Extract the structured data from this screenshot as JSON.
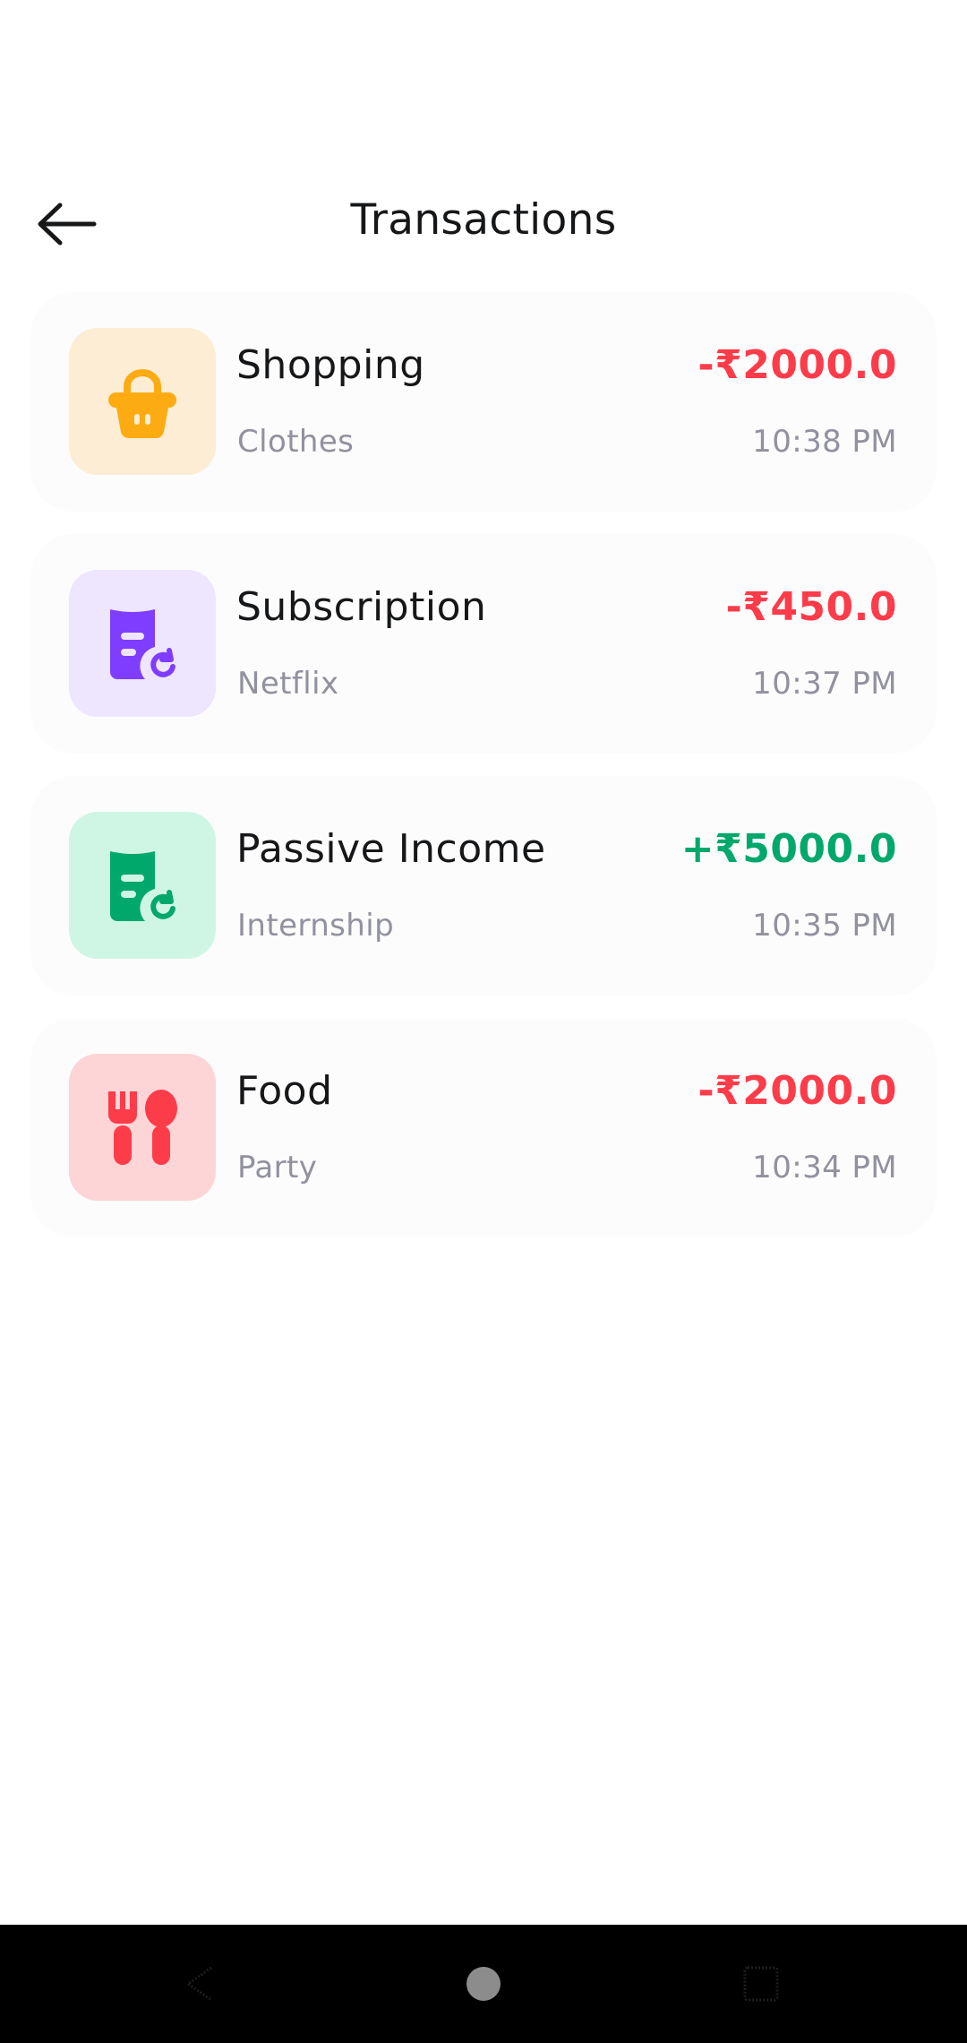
{
  "header": {
    "title": "Transactions"
  },
  "transactions": [
    {
      "category": "Shopping",
      "description": "Clothes",
      "amount": "-₹2000.0",
      "time": "10:38 PM",
      "icon": "shopping-basket-icon",
      "tile_color": "#fcedd4",
      "icon_color": "#fcac12",
      "amount_color": "#fd3c4a"
    },
    {
      "category": "Subscription",
      "description": "Netflix",
      "amount": "-₹450.0",
      "time": "10:37 PM",
      "icon": "recurring-bill-icon",
      "tile_color": "#eee5ff",
      "icon_color": "#7f3dff",
      "amount_color": "#fd3c4a"
    },
    {
      "category": "Passive Income",
      "description": "Internship",
      "amount": "+₹5000.0",
      "time": "10:35 PM",
      "icon": "recurring-bill-icon",
      "tile_color": "#cff6e5",
      "icon_color": "#00a86b",
      "amount_color": "#00a86b"
    },
    {
      "category": "Food",
      "description": "Party",
      "amount": "-₹2000.0",
      "time": "10:34 PM",
      "icon": "restaurant-icon",
      "tile_color": "#fdd5d7",
      "icon_color": "#fd3c4a",
      "amount_color": "#fd3c4a"
    }
  ]
}
